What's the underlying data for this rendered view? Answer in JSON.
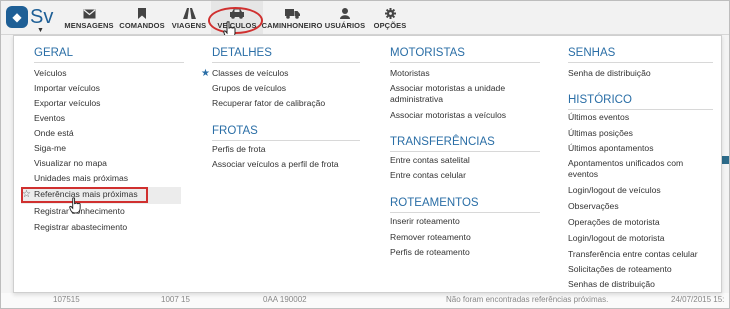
{
  "logo": {
    "text": "Sv"
  },
  "nav": [
    {
      "label": "MENSAGENS",
      "icon": "envelope-icon"
    },
    {
      "label": "COMANDOS",
      "icon": "bookmark-icon"
    },
    {
      "label": "VIAGENS",
      "icon": "road-icon"
    },
    {
      "label": "VEÍCULOS",
      "icon": "car-icon"
    },
    {
      "label": "CAMINHONEIRO",
      "icon": "truck-icon"
    },
    {
      "label": "USUÁRIOS",
      "icon": "user-icon"
    },
    {
      "label": "OPÇÕES",
      "icon": "gear-icon"
    }
  ],
  "menu": {
    "geral": {
      "title": "GERAL",
      "items": [
        "Veículos",
        "Importar veículos",
        "Exportar veículos",
        "Eventos",
        "Onde está",
        "Siga-me",
        "Visualizar no mapa",
        "Unidades mais próximas",
        "Referências mais próximas",
        "Registrar abastecimento"
      ]
    },
    "registrar_conhecimento": "Registrar conhecimento",
    "detalhes": {
      "title": "DETALHES",
      "items": [
        "Classes de veículos",
        "Grupos de veículos",
        "Recuperar fator de calibração"
      ]
    },
    "frotas": {
      "title": "FROTAS",
      "items": [
        "Perfis de frota",
        "Associar veículos a perfil de frota"
      ]
    },
    "motoristas": {
      "title": "MOTORISTAS",
      "items": [
        "Motoristas",
        "Associar motoristas a unidade",
        "administrativa",
        "Associar motoristas a veículos"
      ]
    },
    "transferencias": {
      "title": "TRANSFERÊNCIAS",
      "items": [
        "Entre contas satelital",
        "Entre contas celular"
      ]
    },
    "roteamentos": {
      "title": "ROTEAMENTOS",
      "items": [
        "Inserir roteamento",
        "Remover roteamento",
        "Perfis de roteamento"
      ]
    },
    "senhas": {
      "title": "SENHAS",
      "items": [
        "Senha de distribuição"
      ]
    },
    "historico": {
      "title": "HISTÓRICO",
      "items": [
        "Últimos eventos",
        "Últimas posições",
        "Últimos apontamentos",
        "Apontamentos unificados com",
        "eventos",
        "Login/logout de veículos",
        "Observações",
        "Operações de motorista",
        "Login/logout de motorista",
        "Transferência entre contas celular",
        "Solicitações de roteamento",
        "Senhas de distribuição"
      ]
    }
  },
  "background_row": {
    "c1": "107515",
    "c2": "1007 15",
    "c3": "0AA 190002",
    "c4": "Não foram encontradas referências próximas.",
    "c5": "24/07/2015 15:"
  },
  "colors": {
    "accent": "#2a6ea6",
    "highlight": "#d0302f",
    "logo": "#1e5f96"
  }
}
